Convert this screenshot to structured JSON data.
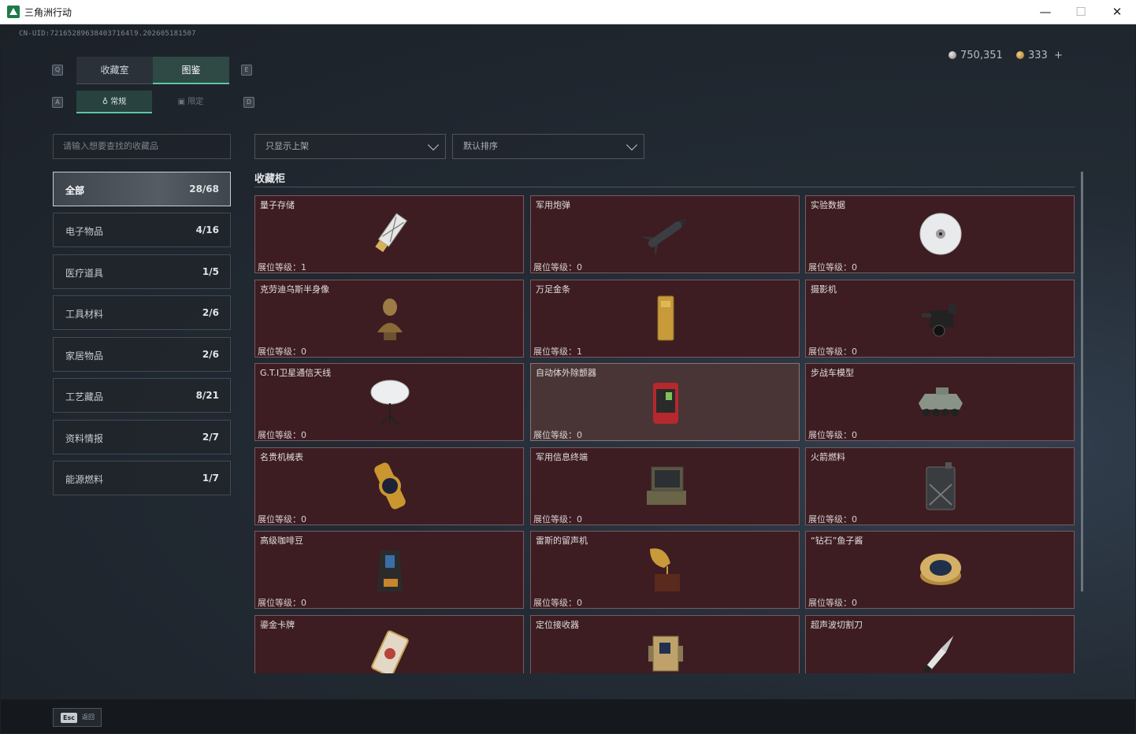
{
  "window": {
    "title": "三角洲行动",
    "minimize": "—",
    "maximize": "☐",
    "close": "✕"
  },
  "uid": "CN-UID:721652896384037164l9.202605181507",
  "currency": {
    "silver": "750,351",
    "gold": "333",
    "add": "+"
  },
  "keycaps": {
    "prev_tab": "Q",
    "next_tab": "E",
    "prev_sub": "A",
    "next_sub": "D"
  },
  "tabs": [
    {
      "label": "收藏室"
    },
    {
      "label": "图鉴",
      "active": true
    }
  ],
  "subtabs": [
    {
      "label": "常规",
      "icon": "flask-icon",
      "active": true
    },
    {
      "label": "限定",
      "icon": "grid-icon"
    }
  ],
  "search": {
    "placeholder": "请输入想要查找的收藏品"
  },
  "categories": [
    {
      "label": "全部",
      "count": "28/68",
      "active": true
    },
    {
      "label": "电子物品",
      "count": "4/16"
    },
    {
      "label": "医疗道具",
      "count": "1/5"
    },
    {
      "label": "工具材料",
      "count": "2/6"
    },
    {
      "label": "家居物品",
      "count": "2/6"
    },
    {
      "label": "工艺藏品",
      "count": "8/21"
    },
    {
      "label": "资料情报",
      "count": "2/7"
    },
    {
      "label": "能源燃料",
      "count": "1/7"
    }
  ],
  "filters": {
    "shelf": "只显示上架",
    "sort": "默认排序"
  },
  "section_title": "收藏柜",
  "level_prefix": "展位等级：",
  "items": [
    {
      "name": "量子存储",
      "level": "1",
      "icon": "usb-drive-icon"
    },
    {
      "name": "军用炮弹",
      "level": "0",
      "icon": "missile-icon"
    },
    {
      "name": "实验数据",
      "level": "0",
      "icon": "disc-icon"
    },
    {
      "name": "克劳迪乌斯半身像",
      "level": "0",
      "icon": "bust-icon"
    },
    {
      "name": "万足金条",
      "level": "1",
      "icon": "gold-bar-icon"
    },
    {
      "name": "摄影机",
      "level": "0",
      "icon": "camera-icon"
    },
    {
      "name": "G.T.I卫星通信天线",
      "level": "0",
      "icon": "satellite-dish-icon"
    },
    {
      "name": "自动体外除颤器",
      "level": "0",
      "icon": "defibrillator-icon",
      "highlight": true
    },
    {
      "name": "步战车模型",
      "level": "0",
      "icon": "ifv-model-icon"
    },
    {
      "name": "名贵机械表",
      "level": "0",
      "icon": "watch-icon"
    },
    {
      "name": "军用信息终端",
      "level": "0",
      "icon": "terminal-icon"
    },
    {
      "name": "火箭燃料",
      "level": "0",
      "icon": "fuel-canister-icon"
    },
    {
      "name": "高级咖啡豆",
      "level": "0",
      "icon": "coffee-bag-icon"
    },
    {
      "name": "雷斯的留声机",
      "level": "0",
      "icon": "gramophone-icon"
    },
    {
      "name": "“钻石”鱼子酱",
      "level": "0",
      "icon": "caviar-tin-icon"
    },
    {
      "name": "鎏金卡牌",
      "level": "",
      "icon": "card-icon"
    },
    {
      "name": "定位接收器",
      "level": "",
      "icon": "receiver-icon"
    },
    {
      "name": "超声波切割刀",
      "level": "",
      "icon": "knife-icon"
    }
  ],
  "footer": {
    "esc_key": "Esc",
    "esc_label": "返回"
  },
  "colors": {
    "accent": "#58c7a0",
    "card_bg": "#3d1d22",
    "card_border": "#7b5a5f"
  }
}
